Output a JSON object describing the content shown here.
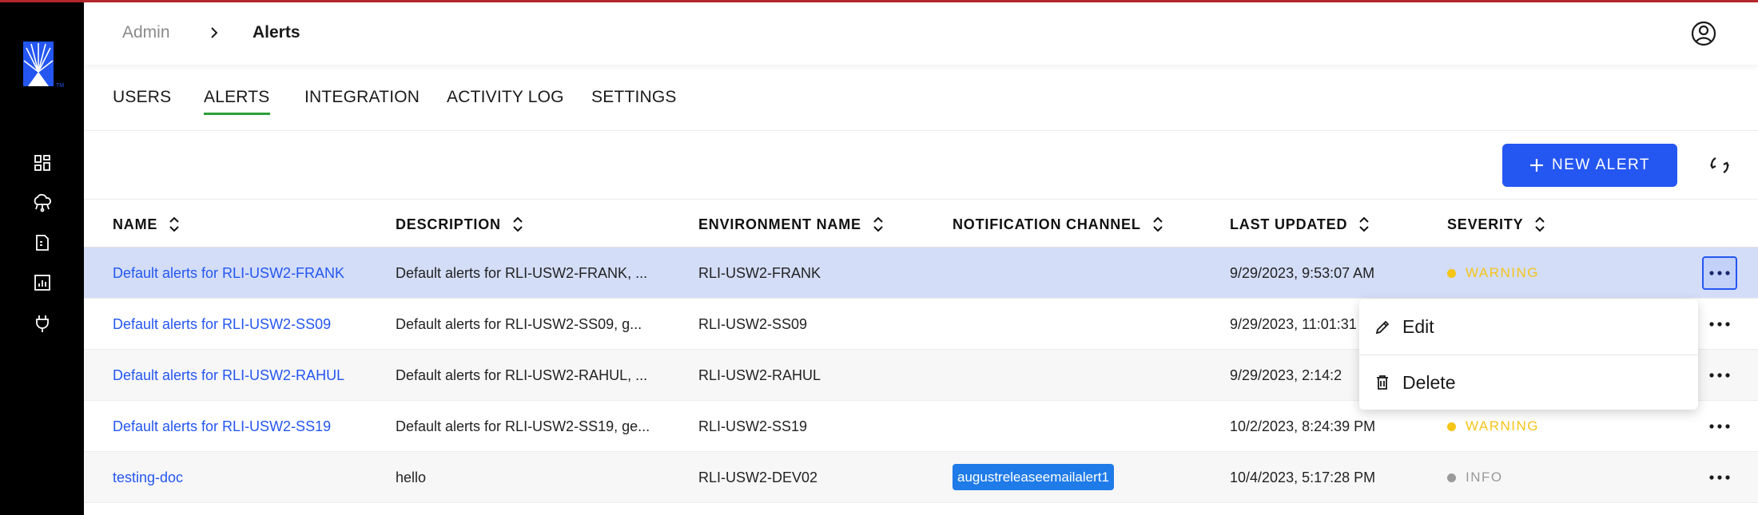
{
  "breadcrumb": {
    "root": "Admin",
    "current": "Alerts"
  },
  "tabs": [
    {
      "label": "USERS",
      "active": false
    },
    {
      "label": "ALERTS",
      "active": true
    },
    {
      "label": "INTEGRATION",
      "active": false
    },
    {
      "label": "ACTIVITY LOG",
      "active": false
    },
    {
      "label": "SETTINGS",
      "active": false
    }
  ],
  "toolbar": {
    "new_alert_label": "NEW ALERT"
  },
  "table": {
    "columns": [
      "NAME",
      "DESCRIPTION",
      "ENVIRONMENT NAME",
      "NOTIFICATION CHANNEL",
      "LAST UPDATED",
      "SEVERITY"
    ],
    "rows": [
      {
        "name": "Default alerts for RLI-USW2-FRANK",
        "description": "Default alerts for RLI-USW2-FRANK, ...",
        "environment": "RLI-USW2-FRANK",
        "channel": "",
        "updated": "9/29/2023, 9:53:07 AM",
        "severity": "WARNING"
      },
      {
        "name": "Default alerts for RLI-USW2-SS09",
        "description": "Default alerts for RLI-USW2-SS09, g...",
        "environment": "RLI-USW2-SS09",
        "channel": "",
        "updated": "9/29/2023, 11:01:31",
        "severity": ""
      },
      {
        "name": "Default alerts for RLI-USW2-RAHUL",
        "description": "Default alerts for RLI-USW2-RAHUL, ...",
        "environment": "RLI-USW2-RAHUL",
        "channel": "",
        "updated": "9/29/2023, 2:14:2",
        "severity": ""
      },
      {
        "name": "Default alerts for RLI-USW2-SS19",
        "description": "Default alerts for RLI-USW2-SS19, ge...",
        "environment": "RLI-USW2-SS19",
        "channel": "",
        "updated": "10/2/2023, 8:24:39 PM",
        "severity": "WARNING"
      },
      {
        "name": "testing-doc",
        "description": "hello",
        "environment": "RLI-USW2-DEV02",
        "channel": "augustreleaseemailalert1",
        "updated": "10/4/2023, 5:17:28 PM",
        "severity": "INFO"
      }
    ]
  },
  "row_menu": {
    "edit_label": "Edit",
    "delete_label": "Delete"
  },
  "colors": {
    "accent": "#2456f2",
    "warning": "#f5c518",
    "info": "#9a9a9a",
    "selected_row": "#d3ddf7",
    "tab_underline": "#2e9e3a",
    "chip": "#1f7be8"
  },
  "icons": {
    "sidebar": [
      "dashboard-icon",
      "cloud-network-icon",
      "document-icon",
      "report-chart-icon",
      "plug-icon"
    ],
    "header": [
      "chevron-right-icon",
      "user-circle-icon"
    ],
    "toolbar": [
      "plus-icon",
      "refresh-icon"
    ],
    "menu": [
      "pencil-icon",
      "trash-icon"
    ]
  }
}
